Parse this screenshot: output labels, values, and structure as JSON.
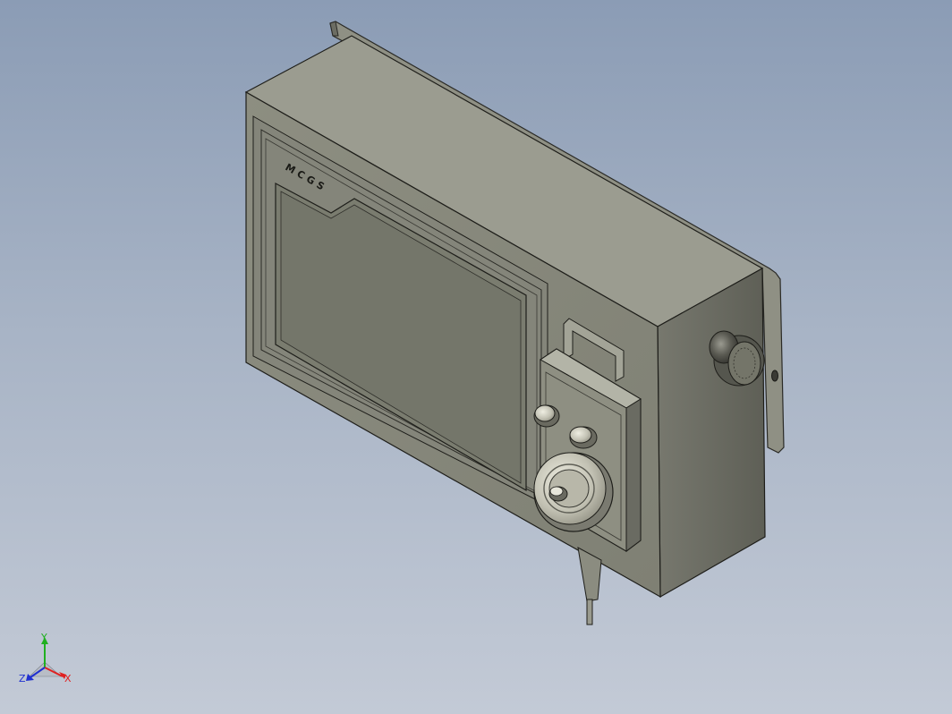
{
  "view": {
    "background_top": "#8b9cb5",
    "background_bottom": "#c3cad6"
  },
  "model": {
    "brand_label": "MCGS",
    "body_color": "#86877a",
    "side_color": "#6e6f65",
    "top_color": "#9a9b8f",
    "screen_color": "#76786b",
    "knob_color": "#c9c8ba",
    "estop_color": "#3c3c36"
  },
  "triad": {
    "x_label": "X",
    "y_label": "Y",
    "z_label": "Z",
    "x_color": "#e02020",
    "y_color": "#20b020",
    "z_color": "#2030d0"
  }
}
